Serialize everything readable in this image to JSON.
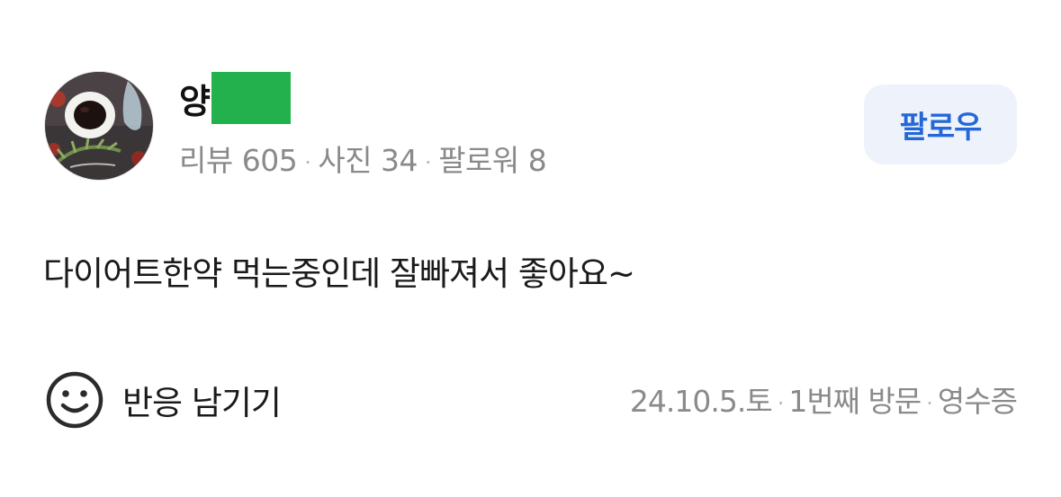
{
  "review": {
    "user": {
      "name_visible": "양",
      "redaction_color": "#22b14c",
      "avatar": "coffee-cup-avatar"
    },
    "stats": {
      "reviews_label": "리뷰 605",
      "photos_label": "사진 34",
      "followers_label": "팔로워 8",
      "separator": "·"
    },
    "follow_button": {
      "label": "팔로우",
      "text_color": "#2468d8",
      "bg_color": "#eef3fb"
    },
    "body": "다이어트한약 먹는중인데 잘빠져서 좋아요~",
    "reaction": {
      "icon": "smiley-icon",
      "label": "반응 남기기"
    },
    "visit": {
      "date": "24.10.5.토",
      "visit_count": "1번째 방문",
      "verification": "영수증",
      "separator": "·"
    }
  }
}
